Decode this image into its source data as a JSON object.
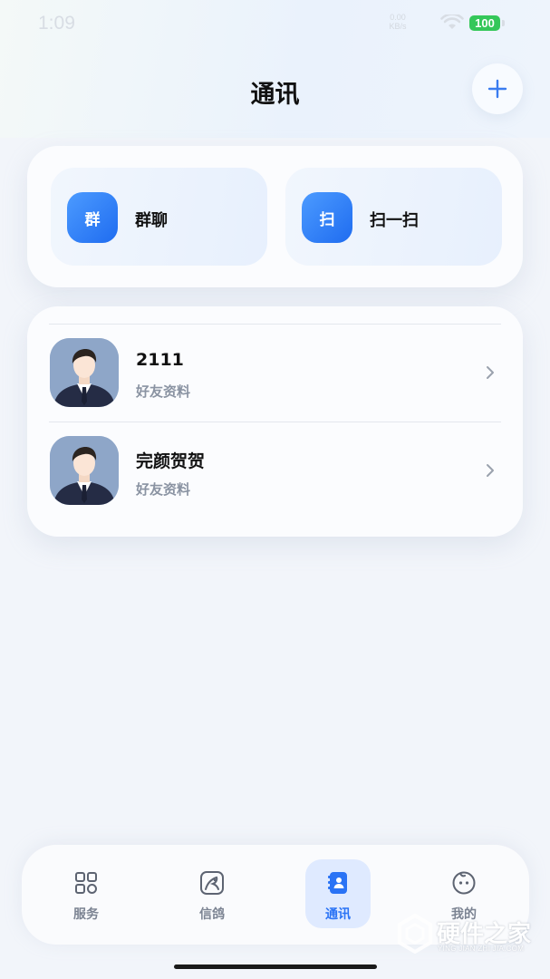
{
  "status_bar": {
    "time": "1:09",
    "net_speed": "0.00 KB/s",
    "battery": "100"
  },
  "header": {
    "title": "通讯"
  },
  "quick_actions": [
    {
      "icon_text": "群",
      "label": "群聊"
    },
    {
      "icon_text": "扫",
      "label": "扫一扫"
    }
  ],
  "contacts": [
    {
      "name": "2111",
      "subtitle": "好友资料"
    },
    {
      "name": "完颜贺贺",
      "subtitle": "好友资料"
    }
  ],
  "bottom_nav": {
    "items": [
      {
        "label": "服务",
        "icon": "grid-icon",
        "active": false
      },
      {
        "label": "信鸽",
        "icon": "pigeon-icon",
        "active": false
      },
      {
        "label": "通讯",
        "icon": "contacts-book-icon",
        "active": true
      },
      {
        "label": "我的",
        "icon": "smiley-face-icon",
        "active": false
      }
    ]
  },
  "watermark": {
    "text": "硬件之家",
    "sub": "YING JIAN ZHI JIA.COM"
  },
  "colors": {
    "accent": "#2a73f5",
    "battery": "#34c759",
    "background": "#f2f5fa"
  }
}
